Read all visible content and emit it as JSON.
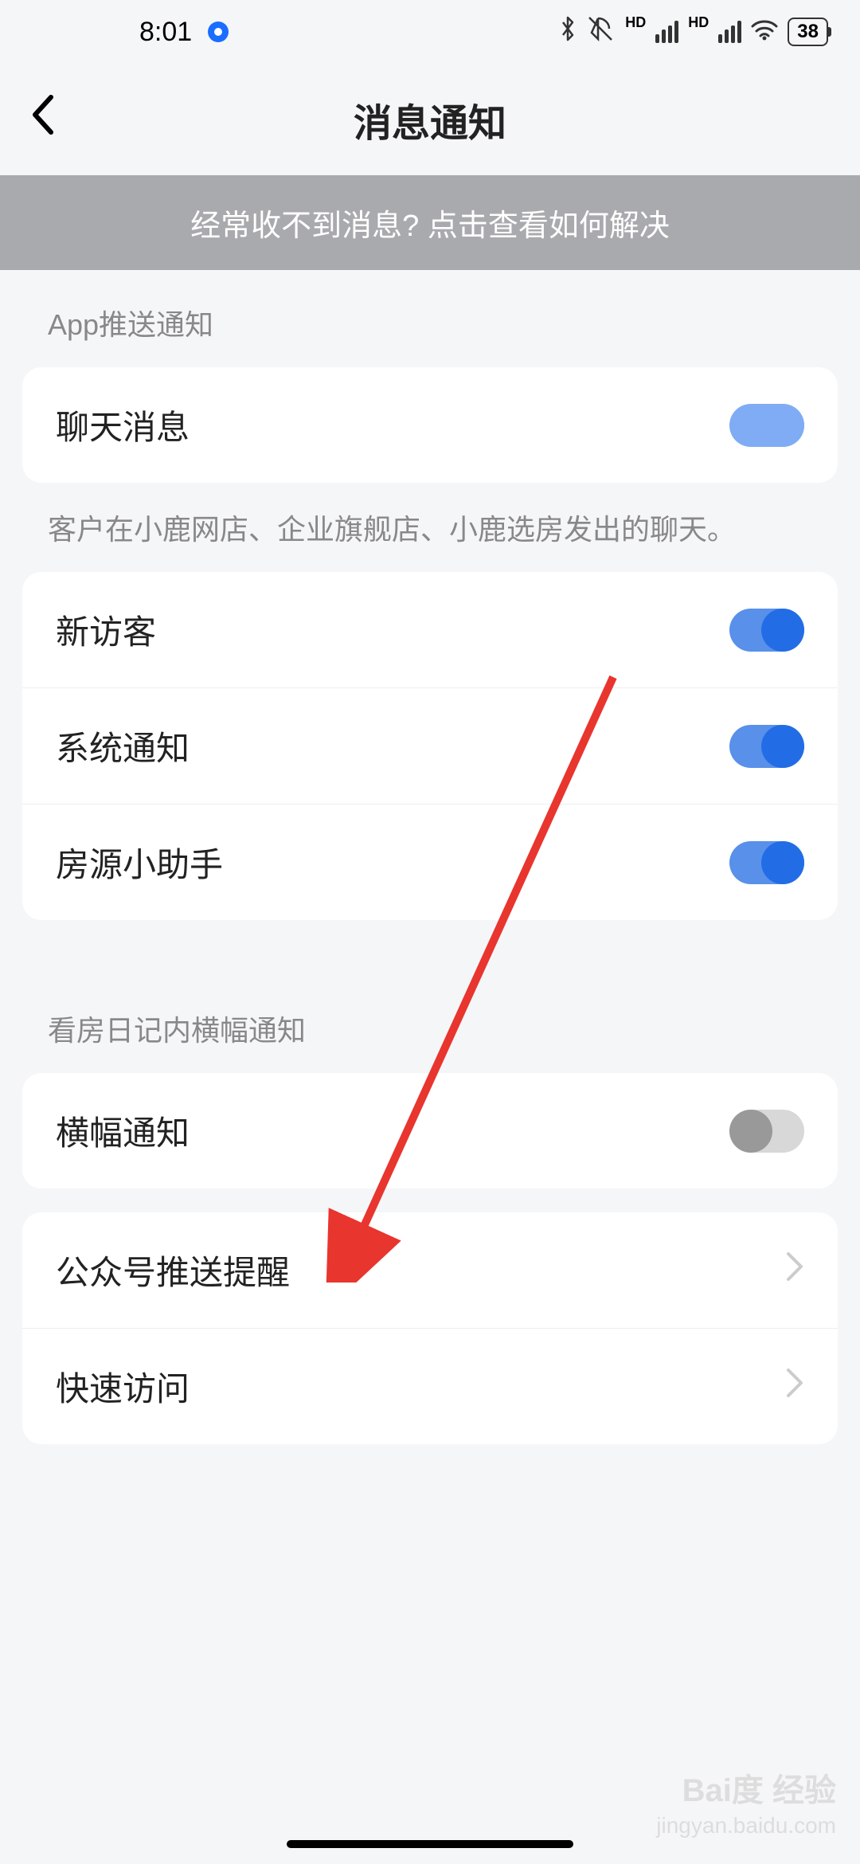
{
  "statusBar": {
    "time": "8:01",
    "battery": "38"
  },
  "header": {
    "title": "消息通知"
  },
  "banner": {
    "text": "经常收不到消息? 点击查看如何解决"
  },
  "sections": [
    {
      "label": "App推送通知",
      "desc": "客户在小鹿网店、企业旗舰店、小鹿选房发出的聊天。",
      "items": [
        {
          "label": "聊天消息",
          "type": "toggle",
          "state": "on-light"
        }
      ],
      "items2": [
        {
          "label": "新访客",
          "type": "toggle",
          "state": "on"
        },
        {
          "label": "系统通知",
          "type": "toggle",
          "state": "on"
        },
        {
          "label": "房源小助手",
          "type": "toggle",
          "state": "on"
        }
      ]
    },
    {
      "label": "看房日记内横幅通知",
      "items": [
        {
          "label": "横幅通知",
          "type": "toggle",
          "state": "off"
        }
      ],
      "items2": [
        {
          "label": "公众号推送提醒",
          "type": "nav"
        },
        {
          "label": "快速访问",
          "type": "nav"
        }
      ]
    }
  ],
  "watermark": {
    "brand": "Bai度 经验",
    "url": "jingyan.baidu.com"
  }
}
